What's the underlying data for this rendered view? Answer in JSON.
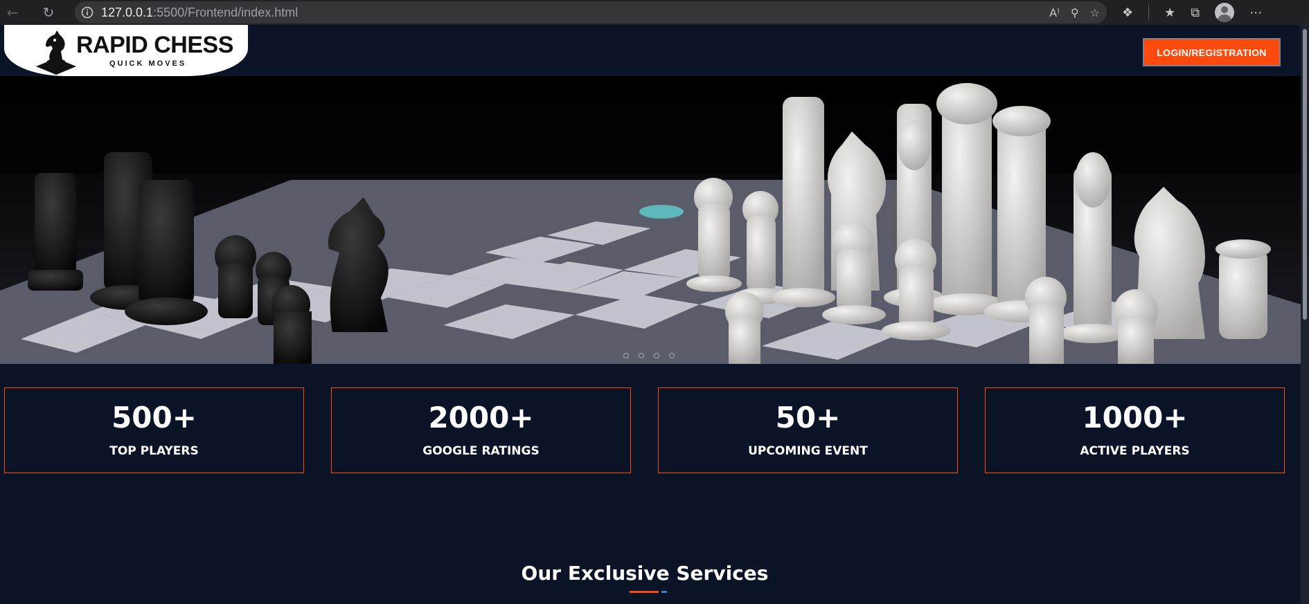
{
  "browser": {
    "url_host": "127.0.0.1",
    "url_rest": ":5500/Frontend/index.html"
  },
  "header": {
    "logo_title": "RAPID CHESS",
    "logo_subtitle": "QUICK MOVES",
    "login_label": "LOGIN/REGISTRATION"
  },
  "hero": {
    "slide_count": 4
  },
  "stats": [
    {
      "value": "500+",
      "label": "TOP PLAYERS"
    },
    {
      "value": "2000+",
      "label": "GOOGLE RATINGS"
    },
    {
      "value": "50+",
      "label": "UPCOMING EVENT"
    },
    {
      "value": "1000+",
      "label": "ACTIVE PLAYERS"
    }
  ],
  "services": {
    "title": "Our Exclusive Services"
  },
  "colors": {
    "accent": "#ff4a0e",
    "background": "#0a1426"
  }
}
